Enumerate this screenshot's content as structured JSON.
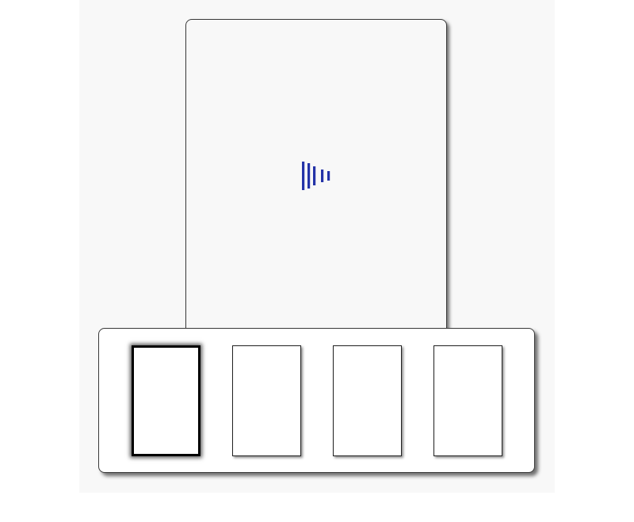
{
  "colors": {
    "accent": "#2433a8",
    "stage_background": "#f8f8f8",
    "card_border": "#3a3a3a"
  },
  "icons": {
    "logo": "sound-bars-icon"
  },
  "thumbnails": {
    "count": 4,
    "selected_index": 0
  }
}
